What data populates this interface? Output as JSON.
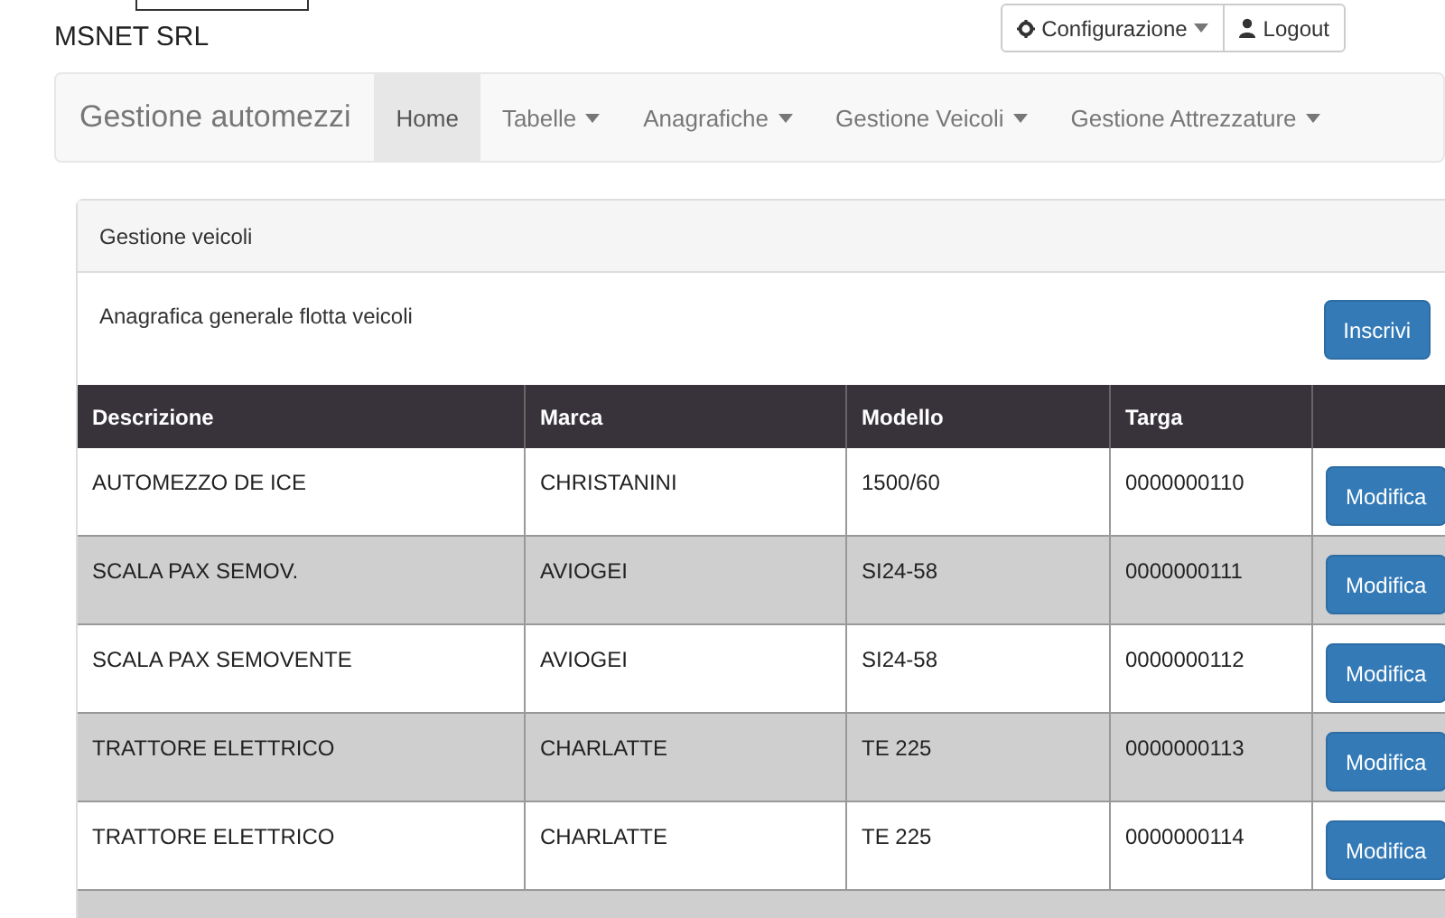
{
  "brand": "MSNET SRL",
  "top_buttons": [
    {
      "label": "Configurazione",
      "kind": "settings",
      "caret": true
    },
    {
      "label": "Logout",
      "kind": "account",
      "caret": false
    }
  ],
  "navbar": {
    "title": "Gestione automezzi",
    "items": [
      {
        "label": "Home",
        "selected": true,
        "dropdown": false
      },
      {
        "label": "Tabelle",
        "selected": false,
        "dropdown": true
      },
      {
        "label": "Anagrafiche",
        "selected": false,
        "dropdown": true
      },
      {
        "label": "Gestione Veicoli",
        "selected": false,
        "dropdown": true
      },
      {
        "label": "Gestione Attrezzature",
        "selected": false,
        "dropdown": true
      }
    ]
  },
  "panel": {
    "heading": "Gestione veicoli",
    "description": "Anagrafica generale flotta veicoli",
    "add_button": "Inscrivi"
  },
  "table": {
    "columns": [
      "Descrizione",
      "Marca",
      "Modello",
      "Targa"
    ],
    "rows": [
      {
        "cells": [
          "AUTOMEZZO DE ICE",
          "CHRISTANINI",
          "1500/60",
          "0000000110"
        ],
        "action": "Modifica"
      },
      {
        "cells": [
          "SCALA PAX SEMOV.",
          "AVIOGEI",
          "SI24-58",
          "0000000111"
        ],
        "action": "Modifica"
      },
      {
        "cells": [
          "SCALA PAX SEMOVENTE",
          "AVIOGEI",
          "SI24-58",
          "0000000112"
        ],
        "action": "Modifica"
      },
      {
        "cells": [
          "TRATTORE ELETTRICO",
          "CHARLATTE",
          "TE 225",
          "0000000113"
        ],
        "action": "Modifica"
      },
      {
        "cells": [
          "TRATTORE ELETTRICO",
          "CHARLATTE",
          "TE 225",
          "0000000114"
        ],
        "action": "Modifica"
      }
    ]
  }
}
